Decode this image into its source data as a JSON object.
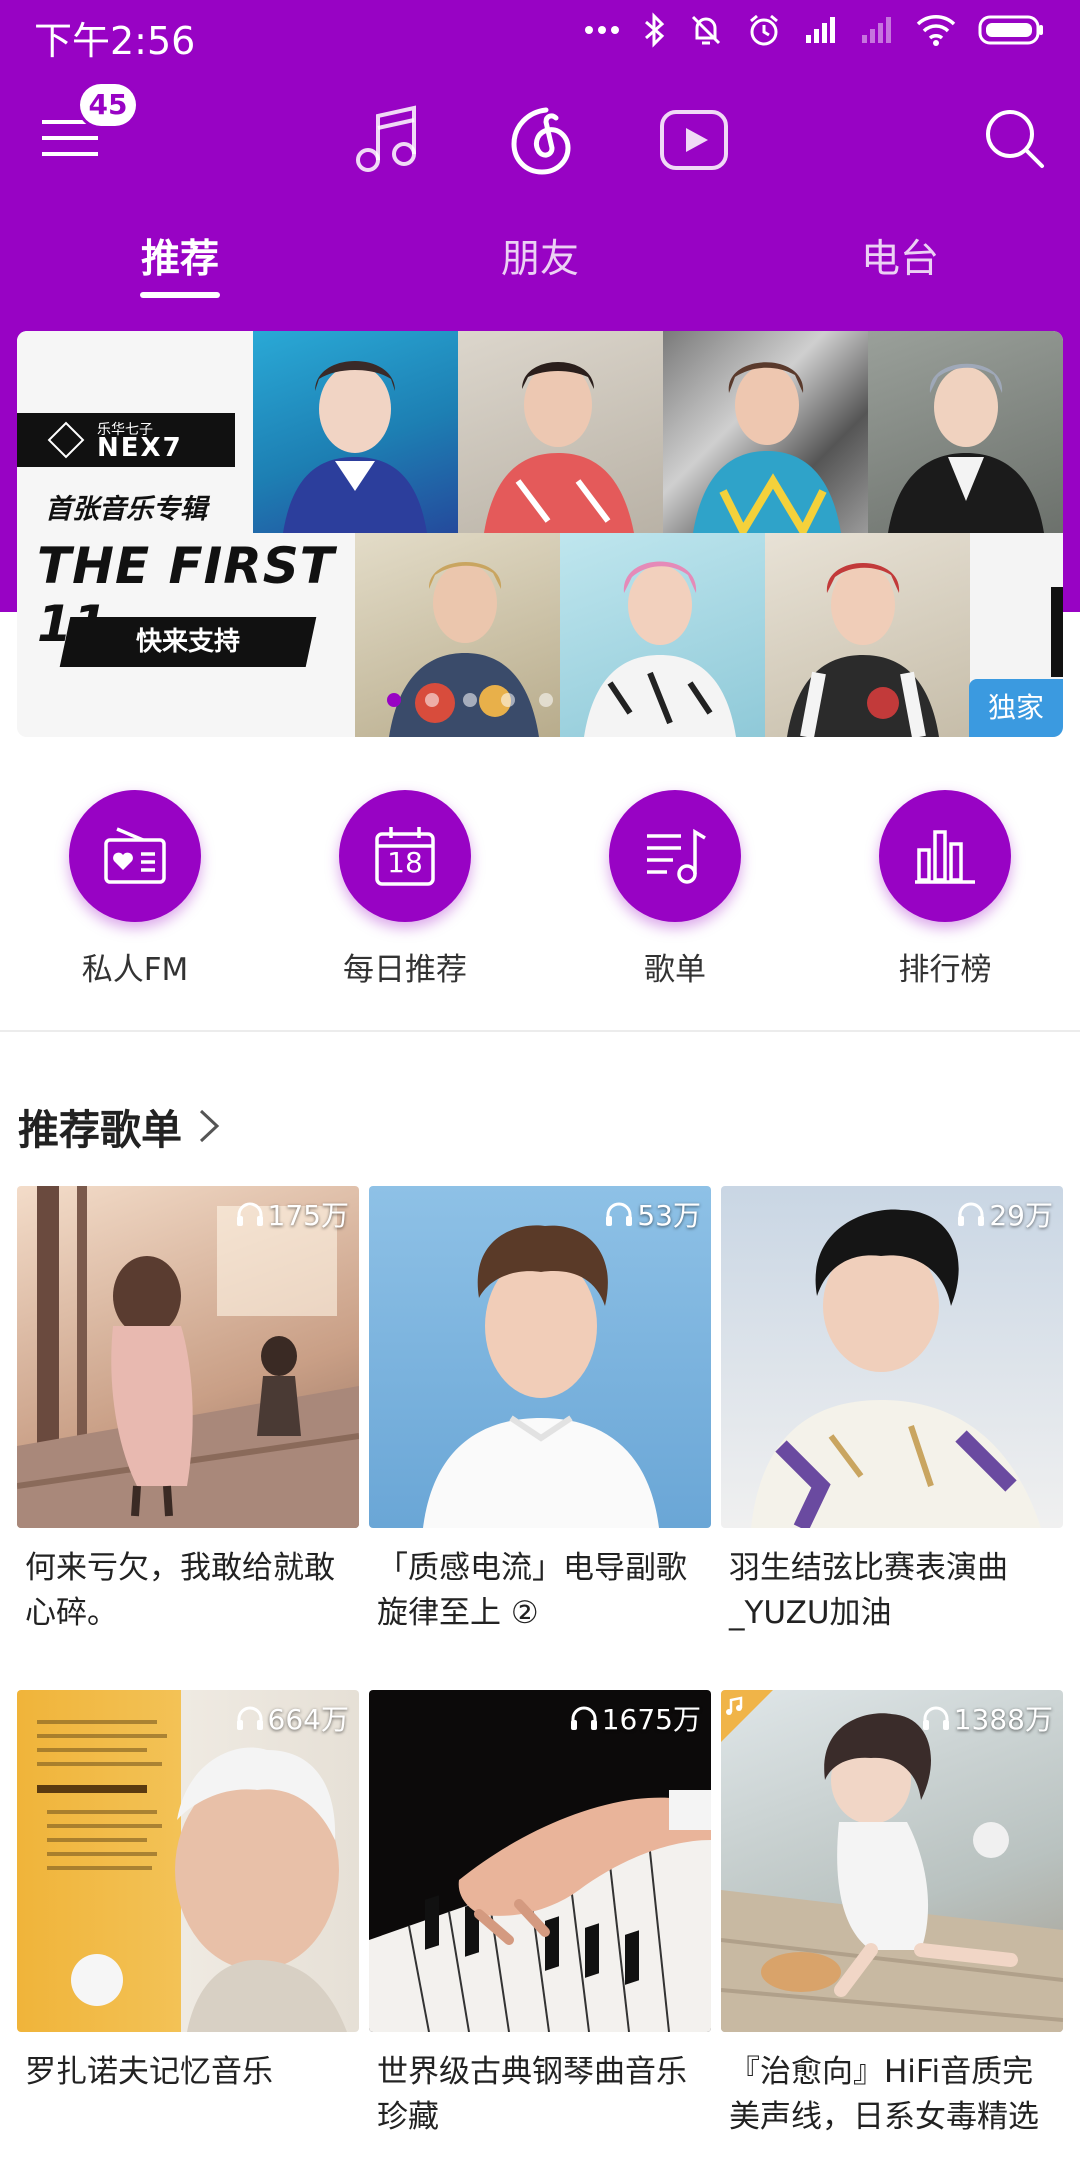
{
  "status_bar": {
    "time": "下午2:56"
  },
  "header": {
    "notification_count": "45"
  },
  "tabs": [
    {
      "label": "推荐",
      "active": true
    },
    {
      "label": "朋友",
      "active": false
    },
    {
      "label": "电台",
      "active": false
    }
  ],
  "banner": {
    "brand_small": "乐华七子",
    "brand": "NEX7",
    "subtitle": "首张音乐专辑",
    "headline": "THE FIRST 11",
    "cta": "快来支持",
    "tag": "独家",
    "page_count": 5,
    "active_page": 0
  },
  "quick_actions": [
    {
      "label": "私人FM",
      "icon": "radio-heart-icon"
    },
    {
      "label": "每日推荐",
      "icon": "calendar-icon",
      "icon_text": "18"
    },
    {
      "label": "歌单",
      "icon": "playlist-icon"
    },
    {
      "label": "排行榜",
      "icon": "chart-bars-icon"
    }
  ],
  "section": {
    "title": "推荐歌单"
  },
  "playlists": [
    {
      "title": "何来亏欠，我敢给就敢心碎。",
      "plays": "175万"
    },
    {
      "title": "「质感电流」电导副歌旋律至上 ②",
      "plays": "53万"
    },
    {
      "title": "羽生结弦比赛表演曲_YUZU加油",
      "plays": "29万"
    },
    {
      "title": "罗扎诺夫记忆音乐",
      "plays": "664万"
    },
    {
      "title": "世界级古典钢琴曲音乐珍藏",
      "plays": "1675万"
    },
    {
      "title": "『治愈向』HiFi音质完美声线，日系女毒精选",
      "plays": "1388万"
    }
  ],
  "colors": {
    "brand": "#9803c4",
    "tag_blue": "#3b9ae0"
  }
}
